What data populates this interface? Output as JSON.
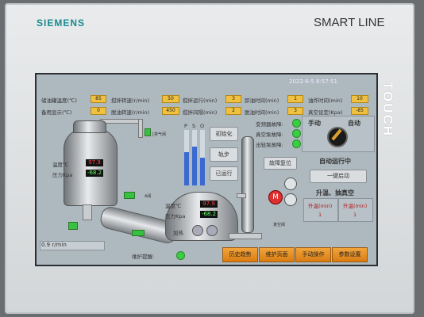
{
  "bezel": {
    "brand": "SIEMENS",
    "product": "SMART LINE",
    "touch": "TOUCH"
  },
  "screen": {
    "datetime": "2022-6-5 8:57:51",
    "params_row1": [
      {
        "label": "储油罐温度(℃)",
        "value": "85"
      },
      {
        "label": "搅拌转速(r/min)",
        "value": "50"
      },
      {
        "label": "搅拌运行(min)",
        "value": "3"
      },
      {
        "label": "卸油时间(min)",
        "value": "1"
      },
      {
        "label": "油炸时间(min)",
        "value": "10"
      }
    ],
    "params_row2": [
      {
        "label": "备用显示(℃)",
        "value": "0"
      },
      {
        "label": "脱油转速(r/min)",
        "value": "450"
      },
      {
        "label": "搅拌间隔(min)",
        "value": "2"
      },
      {
        "label": "脱油时间(min)",
        "value": "3"
      },
      {
        "label": "真空设定(Kpa)",
        "value": "-85"
      }
    ],
    "scale_labels": [
      "P",
      "S",
      "O"
    ],
    "buttons": {
      "init": "初始化",
      "step": "轨步",
      "running": "已运行",
      "fault_reset": "故障复位",
      "one_key_start": "一键启动"
    },
    "faults": [
      "变频器故障:",
      "真空泵故障:",
      "出轻泵故障:"
    ],
    "mode": {
      "manual": "手动",
      "auto": "自动",
      "status": "自动运行中"
    },
    "heat_vac": {
      "title": "升温、抽真空",
      "cols": [
        {
          "label": "升温(min)",
          "value": "1"
        },
        {
          "label": "升温(min)",
          "value": "1"
        }
      ]
    },
    "tank1": {
      "temp_label": "温度℃",
      "temp": "97.9",
      "press_label": "压力Kpa",
      "press": "-68.2"
    },
    "tank2": {
      "temp_label": "温度℃",
      "temp": "97.9",
      "press_label": "压力Kpa",
      "press": "-68.2"
    },
    "small_labels": {
      "exhaust": "[排气阀",
      "a_valve": "A阀",
      "heat": "加热",
      "vac_valve": "真空阀",
      "motor": "M",
      "speed": "0.9 r/min",
      "maint": "维护提醒:"
    },
    "nav": [
      "历史趋势",
      "维护页面",
      "手动操作",
      "参数设置"
    ]
  }
}
